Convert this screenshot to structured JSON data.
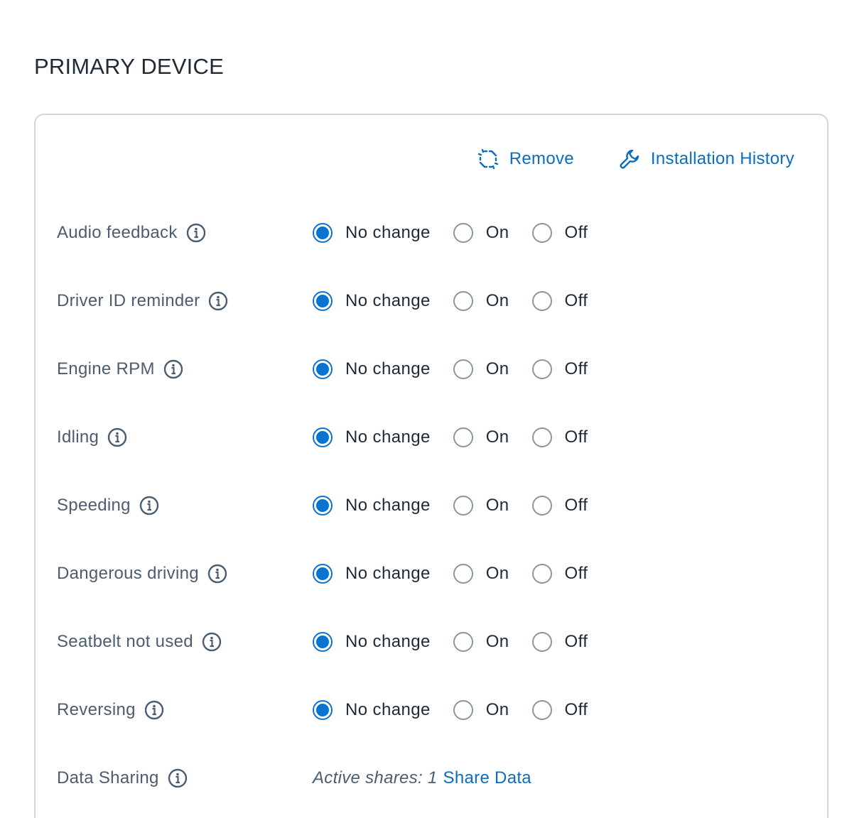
{
  "section": {
    "title": "PRIMARY DEVICE"
  },
  "actions": {
    "remove_label": "Remove",
    "remove_icon": "unlink-icon",
    "history_label": "Installation History",
    "history_icon": "wrench-icon"
  },
  "options": [
    "No change",
    "On",
    "Off"
  ],
  "settings": [
    {
      "label": "Audio feedback",
      "selected": "No change"
    },
    {
      "label": "Driver ID reminder",
      "selected": "No change"
    },
    {
      "label": "Engine RPM",
      "selected": "No change"
    },
    {
      "label": "Idling",
      "selected": "No change"
    },
    {
      "label": "Speeding",
      "selected": "No change"
    },
    {
      "label": "Dangerous driving",
      "selected": "No change"
    },
    {
      "label": "Seatbelt not used",
      "selected": "No change"
    },
    {
      "label": "Reversing",
      "selected": "No change"
    }
  ],
  "data_sharing": {
    "label": "Data Sharing",
    "active_shares_text": "Active shares: 1",
    "link_label": "Share Data"
  },
  "colors": {
    "accent": "#0b74d1",
    "link": "#0b6dbd",
    "label": "#4c5d70",
    "border": "#cfd6de"
  }
}
